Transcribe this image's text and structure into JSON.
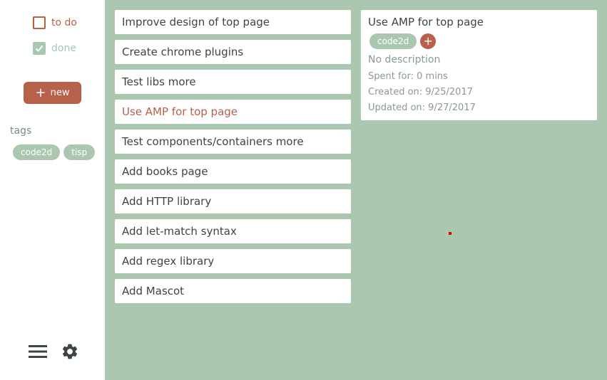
{
  "sidebar": {
    "filters": [
      {
        "label": "to do",
        "checked": false
      },
      {
        "label": "done",
        "checked": true
      }
    ],
    "new_button_label": "new",
    "tags_heading": "tags",
    "tags": [
      "code2d",
      "tisp"
    ],
    "icons": [
      "menu-icon",
      "gear-icon"
    ]
  },
  "tasks": [
    {
      "label": "Improve design of top page"
    },
    {
      "label": "Create chrome plugins"
    },
    {
      "label": "Test libs more"
    },
    {
      "label": "Use AMP for top page",
      "active": true
    },
    {
      "label": "Test components/containers more"
    },
    {
      "label": "Add books page"
    },
    {
      "label": "Add HTTP library"
    },
    {
      "label": "Add let-match syntax"
    },
    {
      "label": "Add regex library"
    },
    {
      "label": "Add Mascot"
    }
  ],
  "detail": {
    "title": "Use AMP for top page",
    "tags": [
      "code2d"
    ],
    "description": "No description",
    "spent": "Spent for: 0 mins",
    "created": "Created on: 9/25/2017",
    "updated": "Updated on: 9/27/2017"
  },
  "colors": {
    "accent": "#b7604a",
    "main_bg": "#acc7b0",
    "text": "#3b4644",
    "muted": "#8a9a96"
  }
}
